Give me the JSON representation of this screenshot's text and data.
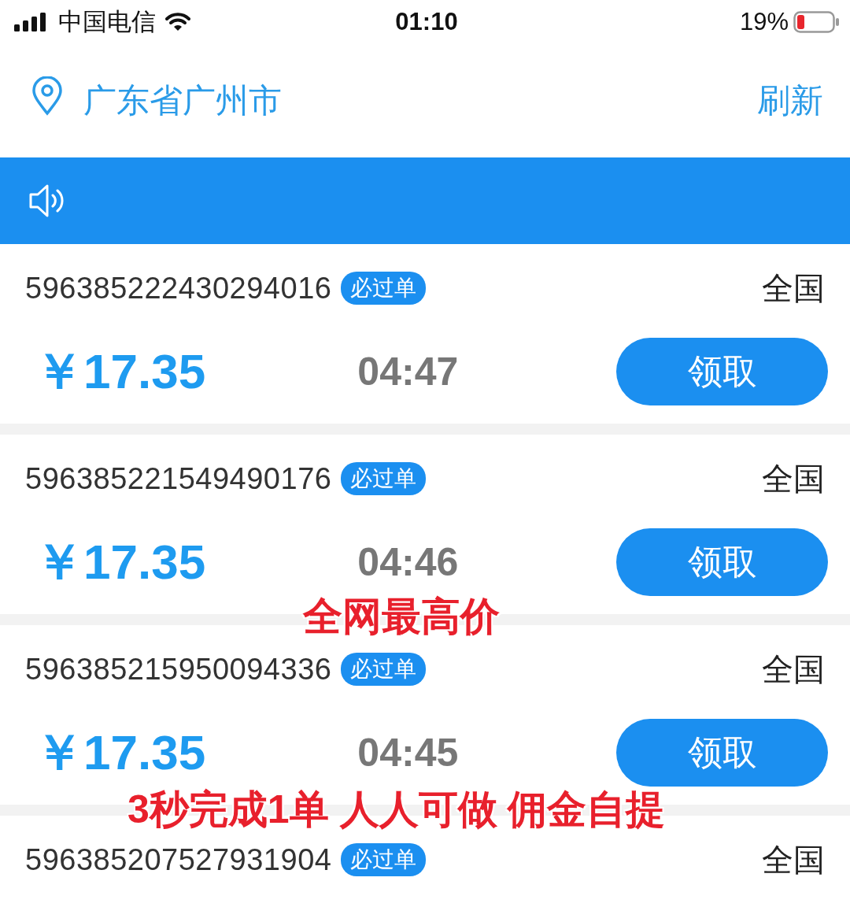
{
  "status_bar": {
    "carrier": "中国电信",
    "time": "01:10",
    "battery": "19%"
  },
  "location": {
    "city": "广东省广州市",
    "refresh": "刷新"
  },
  "orders": [
    {
      "id": "596385222430294016",
      "badge": "必过单",
      "region": "全国",
      "price": "￥17.35",
      "timer": "04:47",
      "button": "领取"
    },
    {
      "id": "596385221549490176",
      "badge": "必过单",
      "region": "全国",
      "price": "￥17.35",
      "timer": "04:46",
      "button": "领取"
    },
    {
      "id": "596385215950094336",
      "badge": "必过单",
      "region": "全国",
      "price": "￥17.35",
      "timer": "04:45",
      "button": "领取"
    },
    {
      "id": "596385207527931904",
      "badge": "必过单",
      "region": "全国"
    }
  ],
  "overlay_captions": [
    "全网最高价",
    "3秒完成1单 人人可做 佣金自提"
  ]
}
